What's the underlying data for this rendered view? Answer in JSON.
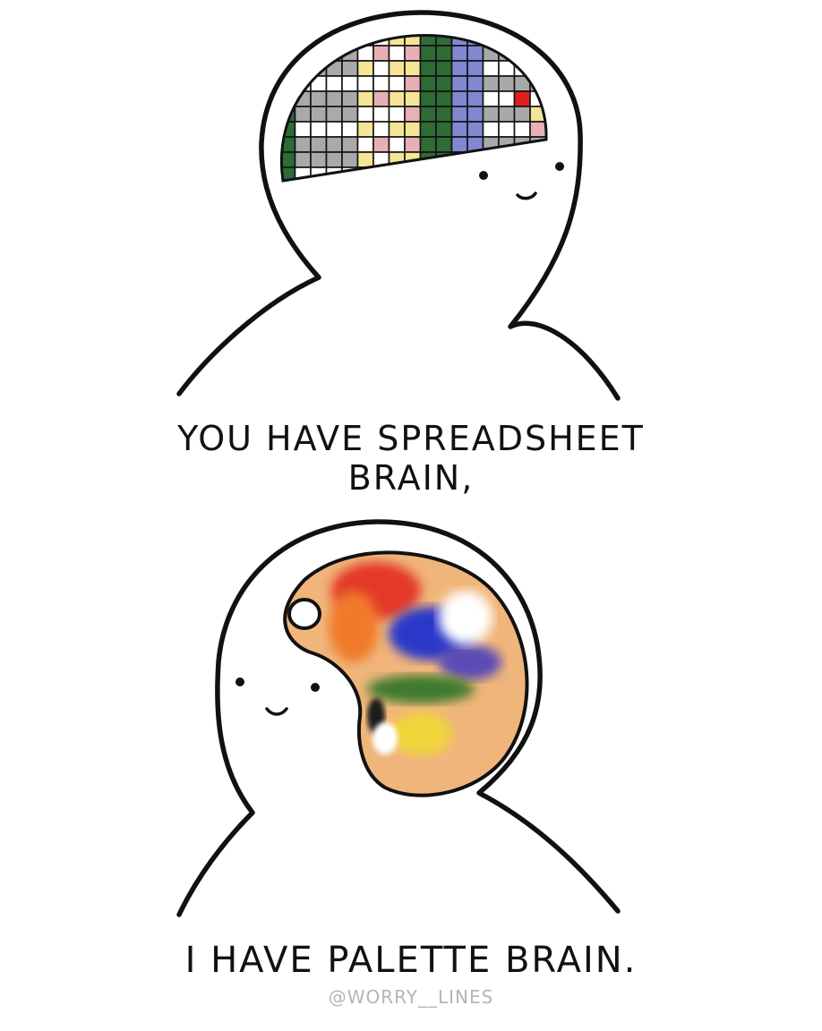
{
  "comic": {
    "panel1": {
      "caption_line1": "YOU HAVE SPREADSHEET",
      "caption_line2": "BRAIN,",
      "grid_colors": {
        "gray": "#a9a9a9",
        "yellow": "#f6e596",
        "pink": "#e8b0b6",
        "green": "#2e6b35",
        "blue": "#7f88d1",
        "red": "#e11d1d",
        "white": "#ffffff"
      }
    },
    "panel2": {
      "caption": "I HAVE PALETTE BRAIN.",
      "palette_color": "#f0b57a",
      "paint_colors": [
        "#e4392c",
        "#f07a2c",
        "#2a37c9",
        "#5a4bb5",
        "#3e7a2e",
        "#f0d63a",
        "#ffffff",
        "#1a1a1a"
      ]
    },
    "credit": "@WORRY__LINES"
  }
}
